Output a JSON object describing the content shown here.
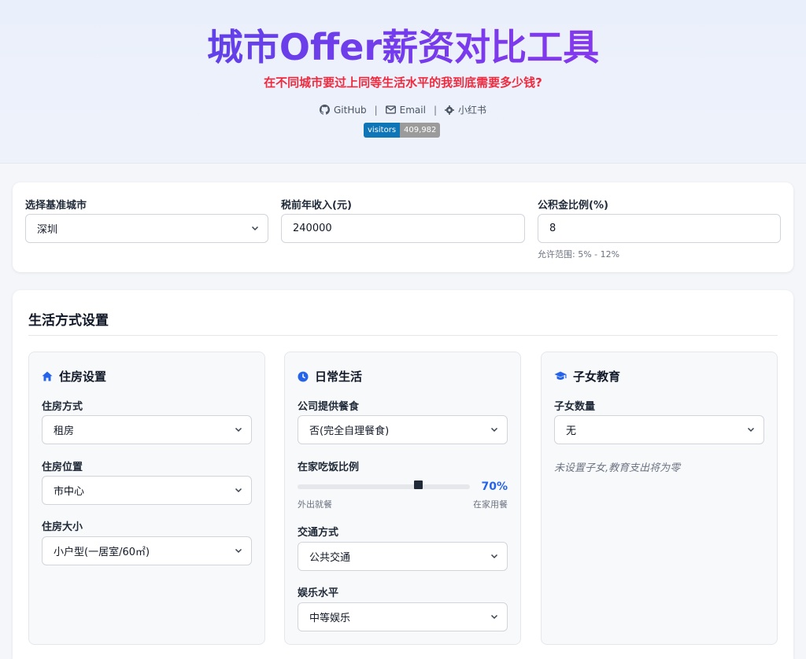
{
  "header": {
    "title": "城市Offer薪资对比工具",
    "subtitle": "在不同城市要过上同等生活水平的我到底需要多少钱?",
    "links": {
      "github": "GitHub",
      "email": "Email",
      "xiaohongshu": "小红书"
    },
    "badge": {
      "label": "visitors",
      "count": "409,982"
    }
  },
  "base": {
    "city_label": "选择基准城市",
    "city_value": "深圳",
    "income_label": "税前年收入(元)",
    "income_value": "240000",
    "fund_label": "公积金比例(%)",
    "fund_value": "8",
    "fund_hint": "允许范围: 5% - 12%"
  },
  "lifestyle": {
    "title": "生活方式设置",
    "housing": {
      "title": "住房设置",
      "type_label": "住房方式",
      "type_value": "租房",
      "location_label": "住房位置",
      "location_value": "市中心",
      "size_label": "住房大小",
      "size_value": "小户型(一居室/60㎡)"
    },
    "daily": {
      "title": "日常生活",
      "meal_label": "公司提供餐食",
      "meal_value": "否(完全自理餐食)",
      "home_ratio_label": "在家吃饭比例",
      "home_ratio_percent": 70,
      "home_ratio_text": "70%",
      "slider_min_label": "外出就餐",
      "slider_max_label": "在家用餐",
      "transport_label": "交通方式",
      "transport_value": "公共交通",
      "entertainment_label": "娱乐水平",
      "entertainment_value": "中等娱乐"
    },
    "education": {
      "title": "子女教育",
      "children_label": "子女数量",
      "children_value": "无",
      "note": "未设置子女,教育支出将为零"
    }
  },
  "colors": {
    "accent": "#2563eb",
    "title_start": "#4f46e5",
    "title_end": "#9333ea",
    "subtitle": "#ef2a3f",
    "badge_left": "#0e75b6",
    "badge_right": "#9b9b9b"
  },
  "icons": [
    "github-icon",
    "email-icon",
    "gear-icon",
    "home-icon",
    "clock-icon",
    "graduation-cap-icon",
    "chevron-down-icon"
  ]
}
